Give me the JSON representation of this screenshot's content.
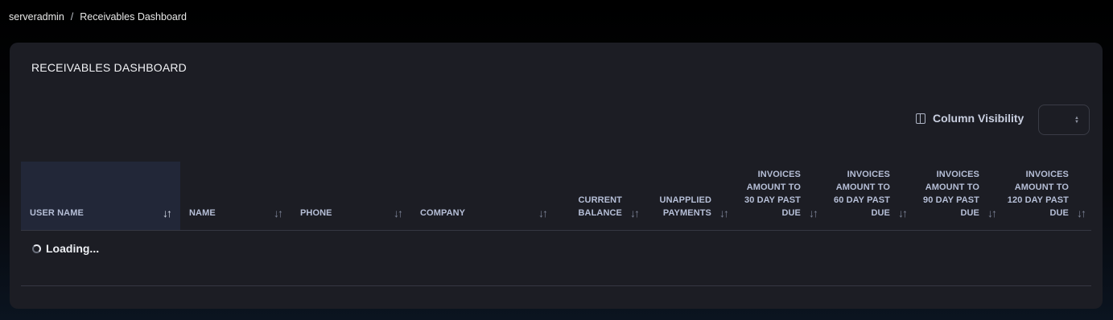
{
  "breadcrumb": {
    "root": "serveradmin",
    "separator": "/",
    "current": "Receivables Dashboard"
  },
  "card": {
    "title": "RECEIVABLES DASHBOARD"
  },
  "toolbar": {
    "column_visibility_label": "Column Visibility",
    "column_visibility_icon": "columns-icon",
    "page_size_select": ""
  },
  "table": {
    "columns": [
      {
        "key": "user_name",
        "label": "USER NAME",
        "sort_icon": "sort-desc-icon",
        "active": true
      },
      {
        "key": "name",
        "label": "NAME",
        "sort_icon": "sort-icon"
      },
      {
        "key": "phone",
        "label": "PHONE",
        "sort_icon": "sort-icon"
      },
      {
        "key": "company",
        "label": "COMPANY",
        "sort_icon": "sort-icon"
      },
      {
        "key": "current_balance",
        "label": "CURRENT BALANCE",
        "sort_icon": "sort-icon"
      },
      {
        "key": "unapplied_payments",
        "label": "UNAPPLIED PAYMENTS",
        "sort_icon": "sort-icon"
      },
      {
        "key": "invoices_30",
        "label": "INVOICES AMOUNT TO 30 DAY PAST DUE",
        "sort_icon": "sort-icon"
      },
      {
        "key": "invoices_60",
        "label": "INVOICES AMOUNT TO 60 DAY PAST DUE",
        "sort_icon": "sort-icon"
      },
      {
        "key": "invoices_90",
        "label": "INVOICES AMOUNT TO 90 DAY PAST DUE",
        "sort_icon": "sort-icon"
      },
      {
        "key": "invoices_120",
        "label": "INVOICES AMOUNT TO 120 DAY PAST DUE",
        "sort_icon": "sort-icon"
      }
    ],
    "status_text": "Loading..."
  }
}
